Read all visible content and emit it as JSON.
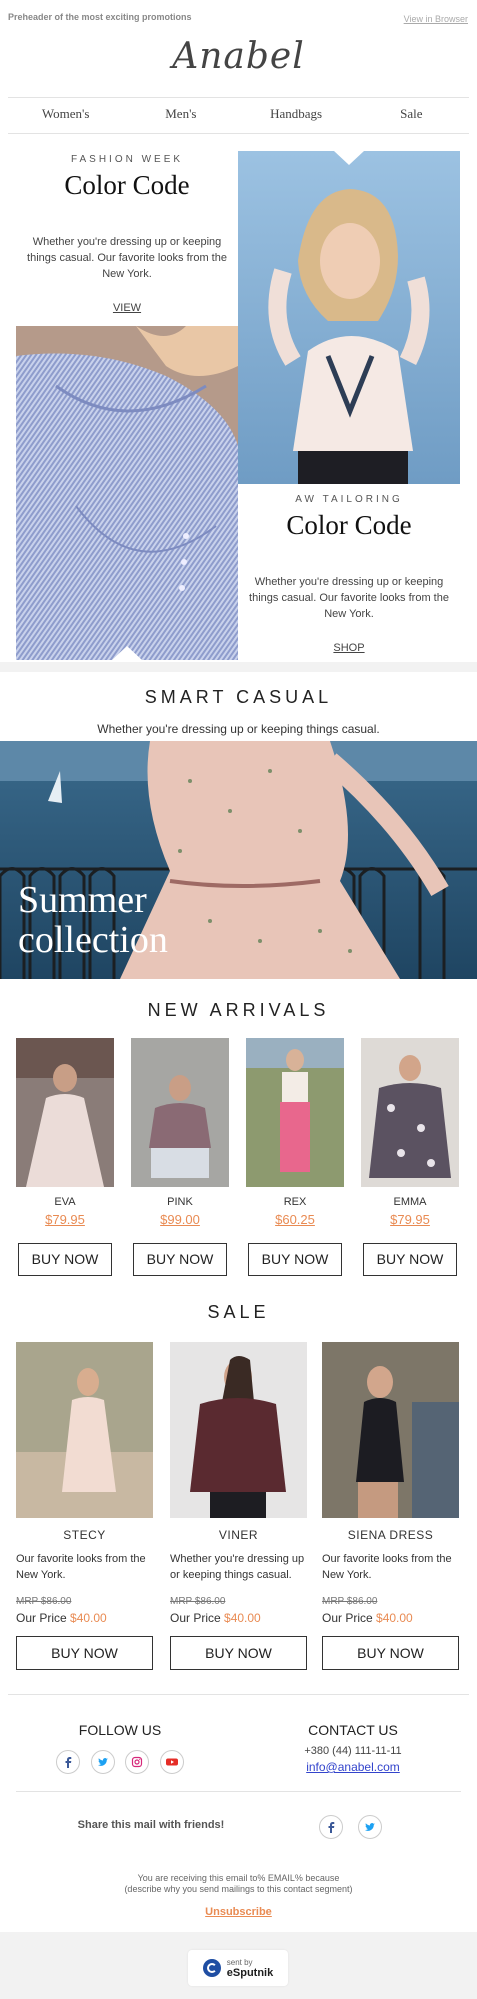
{
  "header": {
    "preheader": "Preheader of the most exciting promotions",
    "view_in_browser": "View in Browser",
    "logo": "Anabel"
  },
  "nav": [
    "Women's",
    "Men's",
    "Handbags",
    "Sale"
  ],
  "hero_left": {
    "eyebrow": "FASHION WEEK",
    "title": "Color Code",
    "copy": "Whether you're dressing up or keeping things casual. Our favorite looks from the New York.",
    "link": "VIEW"
  },
  "hero_right": {
    "eyebrow": "AW TAILORING",
    "title": "Color Code",
    "copy": "Whether you're dressing up or keeping things casual. Our favorite looks from the New York.",
    "link": "SHOP"
  },
  "smart_casual": {
    "title": "SMART CASUAL",
    "subtitle": "Whether you're dressing up or keeping things casual."
  },
  "banner": {
    "line1": "Summer",
    "line2": "collection"
  },
  "new_arrivals": {
    "title": "NEW ARRIVALS",
    "button_label": "BUY NOW",
    "items": [
      {
        "name": "EVA",
        "price": "$79.95"
      },
      {
        "name": "PINK",
        "price": "$99.00"
      },
      {
        "name": "REX",
        "price": "$60.25"
      },
      {
        "name": "EMMA",
        "price": "$79.95"
      }
    ]
  },
  "sale": {
    "title": "SALE",
    "button_label": "BUY NOW",
    "our_price_label": "Our Price",
    "items": [
      {
        "name": "STECY",
        "copy": "Our favorite looks from the New York.",
        "mrp": "MRP $86.00",
        "price": "$40.00"
      },
      {
        "name": "VINER",
        "copy": "Whether you're dressing up or keeping things casual.",
        "mrp": "MRP $86.00",
        "price": "$40.00"
      },
      {
        "name": "SIENA DRESS",
        "copy": "Our favorite looks from the New York.",
        "mrp": "MRP $86.00",
        "price": "$40.00"
      }
    ]
  },
  "footer": {
    "follow_us": "FOLLOW US",
    "contact_us": "CONTACT US",
    "phone": "+380 (44) 111-11-11",
    "email": "info@anabel.com",
    "share": "Share this mail with friends!",
    "notice_line1": "You are receiving this email to% EMAIL% because",
    "notice_line2": "(describe why you send mailings to this contact segment)",
    "unsubscribe": "Unsubscribe",
    "sent_by": "sent by",
    "brand": "eSputnik"
  },
  "colors": {
    "accent": "#e98b53",
    "sky": "#8ab4d8",
    "sea": "#28506e",
    "footer_bg": "#f2f2f2"
  }
}
